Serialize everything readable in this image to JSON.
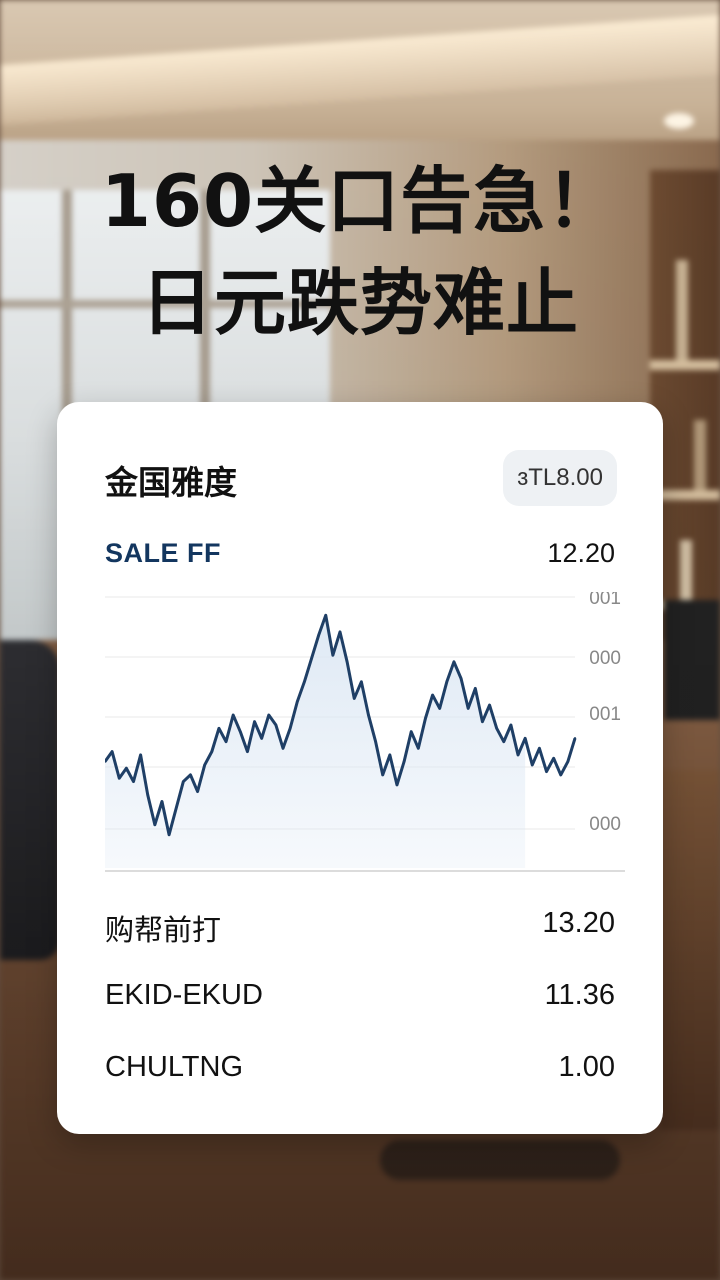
{
  "headline": {
    "line1": "160关口告急！",
    "line2": "日元跌势难止"
  },
  "card": {
    "title": "金国雅度",
    "price_pill": "ɜTL8.00",
    "series_label": "SALE FF",
    "series_value": "12.20",
    "rows": [
      {
        "label": "购帮前打",
        "value": "13.20"
      },
      {
        "label": "EKID-EKUD",
        "value": "11.36"
      },
      {
        "label": "CHULTNG",
        "value": "1.00"
      }
    ]
  },
  "colors": {
    "line": "#1f3f66",
    "fill": "#dde8f4",
    "series_label": "#13365f"
  },
  "chart_data": {
    "type": "line",
    "y_tick_labels": [
      "001",
      "000",
      "001",
      "000"
    ],
    "grid": true,
    "series": [
      {
        "values": [
          3.2,
          3.5,
          2.7,
          3.0,
          2.6,
          3.4,
          2.2,
          1.3,
          2.0,
          1.0,
          1.8,
          2.6,
          2.8,
          2.3,
          3.1,
          3.5,
          4.2,
          3.8,
          4.6,
          4.1,
          3.5,
          4.4,
          3.9,
          4.6,
          4.3,
          3.6,
          4.2,
          5.0,
          5.6,
          6.3,
          7.0,
          7.6,
          6.4,
          7.1,
          6.2,
          5.1,
          5.6,
          4.6,
          3.8,
          2.8,
          3.4,
          2.5,
          3.2,
          4.1,
          3.6,
          4.5,
          5.2,
          4.8,
          5.6,
          6.2,
          5.7,
          4.8,
          5.4,
          4.4,
          4.9,
          4.2,
          3.8,
          4.3,
          3.4,
          3.9,
          3.1,
          3.6,
          2.9,
          3.3,
          2.8,
          3.2,
          3.9
        ]
      }
    ]
  }
}
